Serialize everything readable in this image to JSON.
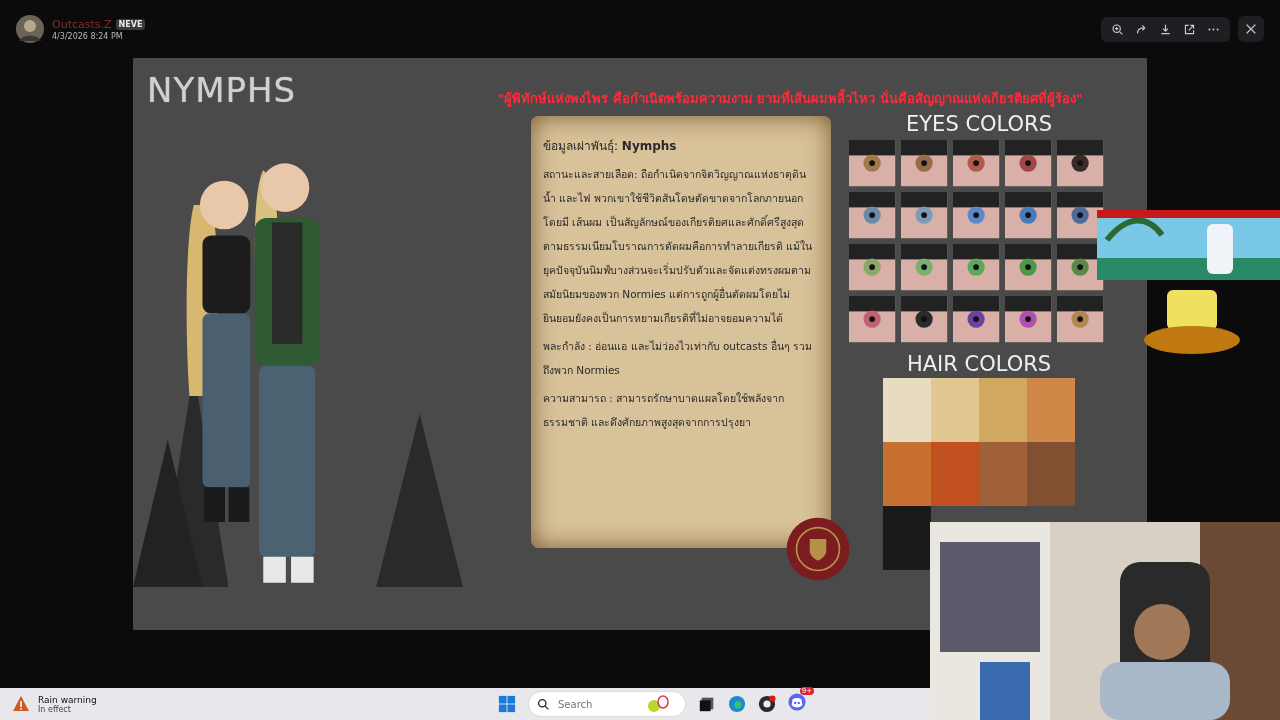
{
  "viewer": {
    "author": "Outcasts.Z",
    "badge": "NEVE",
    "timestamp": "4/3/2026 8:24 PM"
  },
  "image": {
    "title": "NYMPHS",
    "quote": "\"ผู้พิทักษ์แห่งพงไพร คือกำเนิดพร้อมความงาม ยามที่เส้นผมพลิ้วไหว นั่นคือสัญญาณแห่งเกียรติยศที่ผู้ร้อง\"",
    "heading": "ข้อมูลเผ่าพันธุ์: **Nymphs**",
    "paragraphs": [
      "สถานะและสายเลือด: ถือกำเนิดจากจิตวิญญาณแห่งธาตุดิน น้ำ และไฟ พวกเขาใช้ชีวิตสันโดษตัดขาดจากโลกภายนอก โดยมี เส้นผม เป็นสัญลักษณ์ของเกียรติยศและศักดิ์ศรีสูงสุด ตามธรรมเนียมโบราณการตัดผมคือการทำลายเกียรติ แม้ในยุคปัจจุบันนิมฟ์บางส่วนจะเริ่มปรับตัวและจัดแต่งทรงผมตามสมัยนิยมของพวก Normies แต่การถูกผู้อื่นตัดผมโดยไม่ยินยอมยังคงเป็นการหยามเกียรติที่ไม่อาจยอมความได้",
      "พละกำลัง : อ่อนแอ และไม่ว่องไวเท่ากับ outcasts อื่นๆ รวมถึงพวก Normies",
      "ความสามารถ : สามารถรักษาบาดแผลโดยใช้พลังจากธรรมชาติ และดึงศักยภาพสูงสุดจากการปรุงยา"
    ],
    "eyes_title": "EYES COLORS",
    "hair_title": "HAIR COLORS"
  },
  "taskbar": {
    "weather_title": "Rain warning",
    "weather_status": "In effect",
    "search_placeholder": "Search",
    "chat_badge": "9+"
  }
}
